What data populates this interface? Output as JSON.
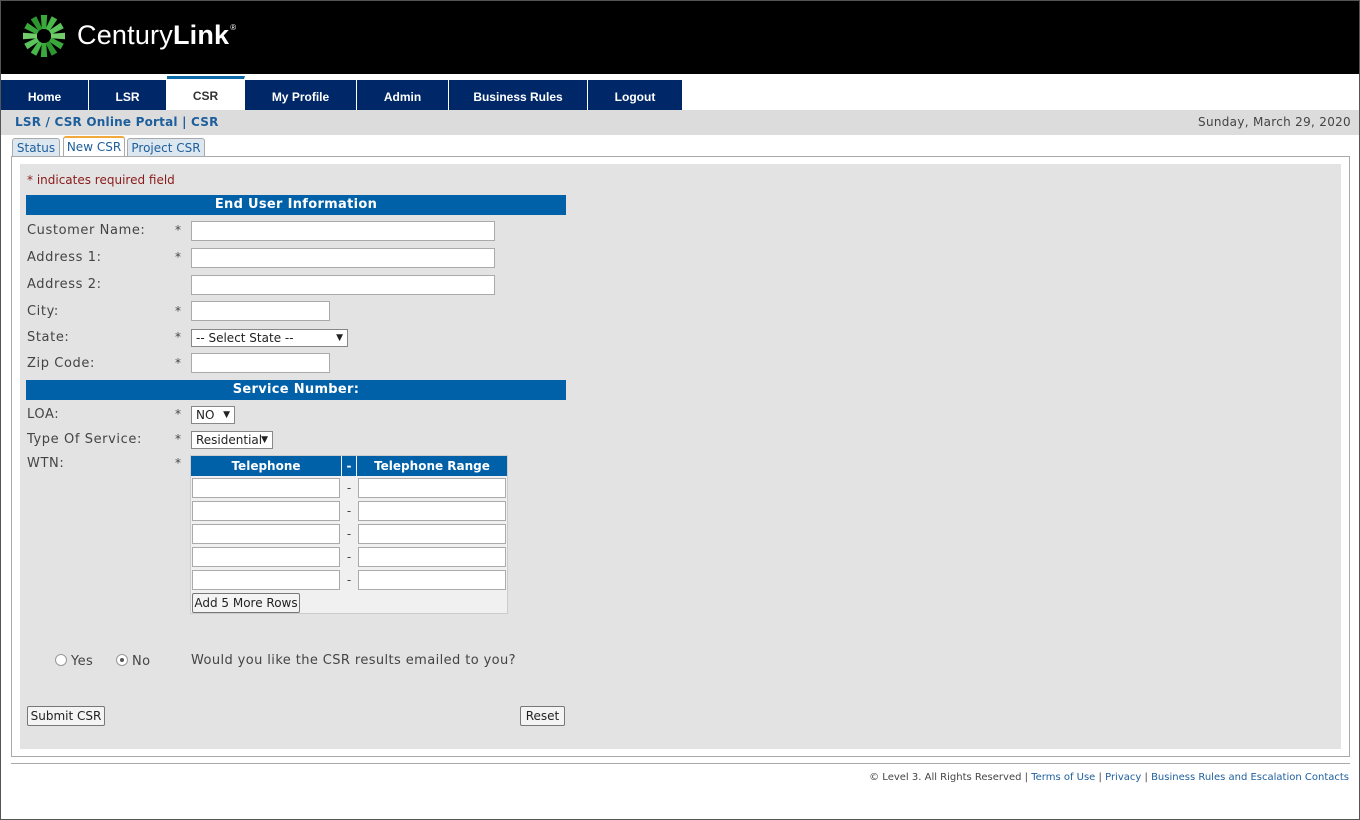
{
  "brand": {
    "name_light": "Century",
    "name_bold": "Link",
    "mark": "®"
  },
  "nav": {
    "items": [
      "Home",
      "LSR",
      "CSR",
      "My Profile",
      "Admin",
      "Business Rules",
      "Logout"
    ],
    "active": "CSR"
  },
  "breadcrumb": "LSR / CSR Online Portal | CSR",
  "date": "Sunday, March 29, 2020",
  "tabs": {
    "items": [
      "Status",
      "New CSR",
      "Project CSR"
    ],
    "active": "New CSR"
  },
  "form": {
    "required_note": "* indicates required field",
    "end_user_header": "End User Information",
    "required_mark": "*",
    "fields": {
      "customer_name": {
        "label": "Customer Name:",
        "value": ""
      },
      "address1": {
        "label": "Address 1:",
        "value": ""
      },
      "address2": {
        "label": "Address 2:",
        "value": ""
      },
      "city": {
        "label": "City:",
        "value": ""
      },
      "state": {
        "label": "State:",
        "selected": "-- Select State --"
      },
      "zip": {
        "label": "Zip Code:",
        "value": ""
      }
    },
    "service_header": "Service Number:",
    "loa": {
      "label": "LOA:",
      "selected": "NO"
    },
    "service_type": {
      "label": "Type Of Service:",
      "selected": "Residential"
    },
    "wtn": {
      "label": "WTN:",
      "col_telephone": "Telephone",
      "col_sep": "-",
      "col_range": "Telephone Range",
      "row_sep": "-",
      "rows": 5,
      "add_rows_label": "Add 5 More Rows"
    },
    "email": {
      "yes_label": "Yes",
      "no_label": "No",
      "selected": "No",
      "question": "Would you like the CSR results emailed to you?"
    },
    "submit_label": "Submit CSR",
    "reset_label": "Reset"
  },
  "footer": {
    "copyright": "© Level 3. All Rights Reserved",
    "sep": "|",
    "links": [
      "Terms of Use",
      "Privacy",
      "Business Rules and Escalation Contacts"
    ]
  },
  "colors": {
    "nav_bg": "#002868",
    "section_bg": "#0060a8",
    "link": "#1d5e9c",
    "required_note": "#8b1a1a",
    "tab_accent": "#f2a93b"
  }
}
